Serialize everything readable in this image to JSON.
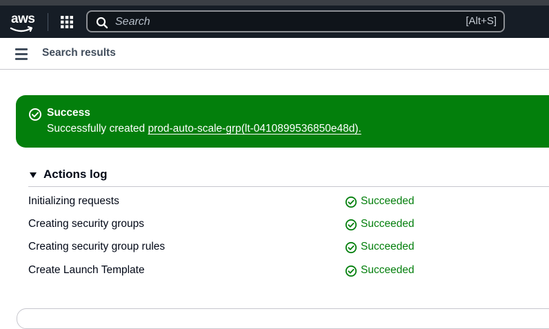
{
  "topbar": {
    "logo_text": "aws",
    "search": {
      "placeholder": "Search",
      "value": "",
      "shortcut": "[Alt+S]"
    }
  },
  "subheader": {
    "breadcrumb": "Search results"
  },
  "flash": {
    "type": "success",
    "title": "Success",
    "message_prefix": "Successfully created ",
    "link_text": "prod-auto-scale-grp(lt-0410899536850e48d).",
    "color": "#037f0c"
  },
  "actions_log": {
    "title": "Actions log",
    "expanded": true,
    "rows": [
      {
        "step": "Initializing requests",
        "status": "Succeeded"
      },
      {
        "step": "Creating security groups",
        "status": "Succeeded"
      },
      {
        "step": "Creating security group rules",
        "status": "Succeeded"
      },
      {
        "step": "Create Launch Template",
        "status": "Succeeded"
      }
    ],
    "status_color": "#037f0c"
  },
  "icons": {
    "logo": "aws-logo-icon",
    "apps": "grid-menu-icon",
    "search": "search-icon",
    "menu": "hamburger-menu-icon",
    "success": "check-circle-icon",
    "expand": "caret-down-icon"
  }
}
